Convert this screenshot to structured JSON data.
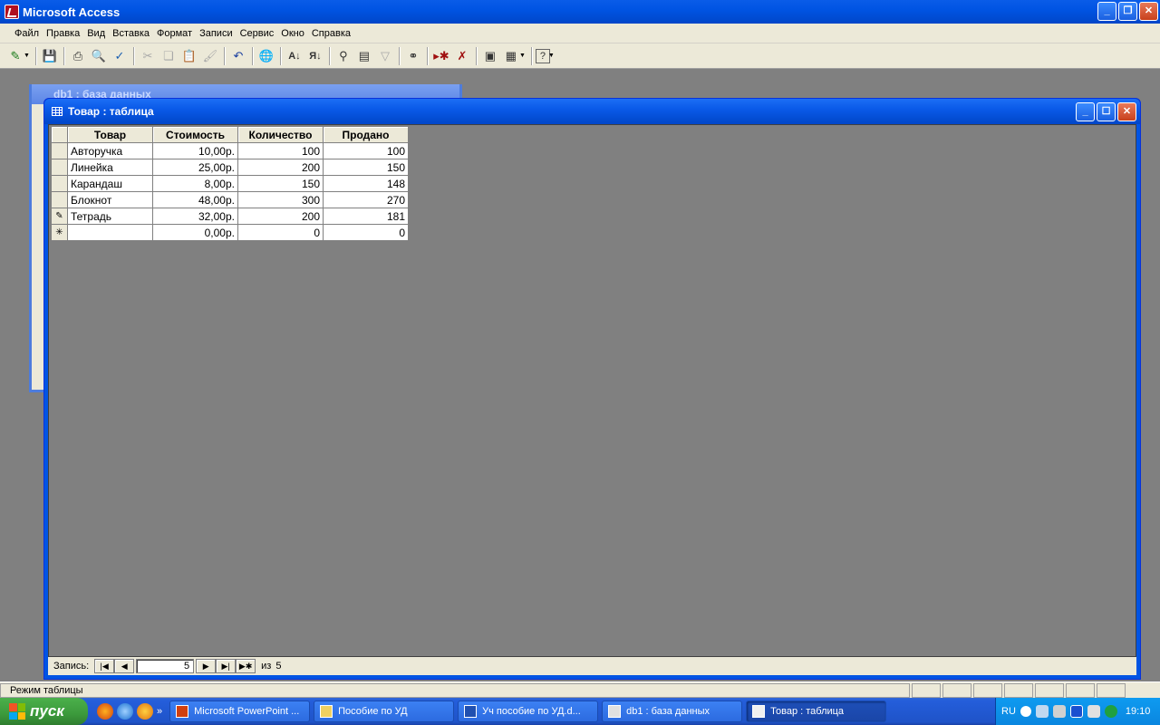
{
  "app": {
    "title": "Microsoft Access"
  },
  "menu": [
    "Файл",
    "Правка",
    "Вид",
    "Вставка",
    "Формат",
    "Записи",
    "Сервис",
    "Окно",
    "Справка"
  ],
  "toolbar_icons": [
    "view-icon",
    "save-icon",
    "print-icon",
    "print-preview-icon",
    "spelling-icon",
    "cut-icon",
    "copy-icon",
    "paste-icon",
    "format-painter-icon",
    "undo-icon",
    "hyperlink-icon",
    "sort-ascending-icon",
    "sort-descending-icon",
    "filter-by-selection-icon",
    "filter-by-form-icon",
    "apply-filter-icon",
    "find-icon",
    "new-record-icon",
    "delete-record-icon",
    "database-window-icon",
    "new-object-icon",
    "help-icon"
  ],
  "background_window": {
    "title": "db1 : база данных"
  },
  "table_window": {
    "title": "Товар : таблица",
    "columns": [
      "Товар",
      "Стоимость",
      "Количество",
      "Продано"
    ],
    "rows": [
      {
        "selector": "",
        "name": "Авторучка",
        "cost": "10,00р.",
        "qty": "100",
        "sold": "100"
      },
      {
        "selector": "",
        "name": "Линейка",
        "cost": "25,00р.",
        "qty": "200",
        "sold": "150"
      },
      {
        "selector": "",
        "name": "Карандаш",
        "cost": "8,00р.",
        "qty": "150",
        "sold": "148"
      },
      {
        "selector": "",
        "name": "Блокнот",
        "cost": "48,00р.",
        "qty": "300",
        "sold": "270"
      },
      {
        "selector": "✎",
        "name": "Тетрадь",
        "cost": "32,00р.",
        "qty": "200",
        "sold": "181"
      },
      {
        "selector": "✳",
        "name": "",
        "cost": "0,00р.",
        "qty": "0",
        "sold": "0"
      }
    ],
    "nav": {
      "label": "Запись:",
      "current": "5",
      "of_label": "из",
      "total": "5"
    }
  },
  "status": {
    "text": "Режим таблицы"
  },
  "taskbar": {
    "start_label": "пуск",
    "tasks": [
      {
        "label": "Microsoft PowerPoint ...",
        "width": 155
      },
      {
        "label": "Пособие по УД",
        "width": 155
      },
      {
        "label": "Уч пособие по УД.d...",
        "width": 155
      },
      {
        "label": "db1 : база данных",
        "width": 155
      },
      {
        "label": "Товар : таблица",
        "width": 155,
        "active": true
      }
    ],
    "tray": {
      "lang": "RU",
      "time": "19:10"
    }
  }
}
